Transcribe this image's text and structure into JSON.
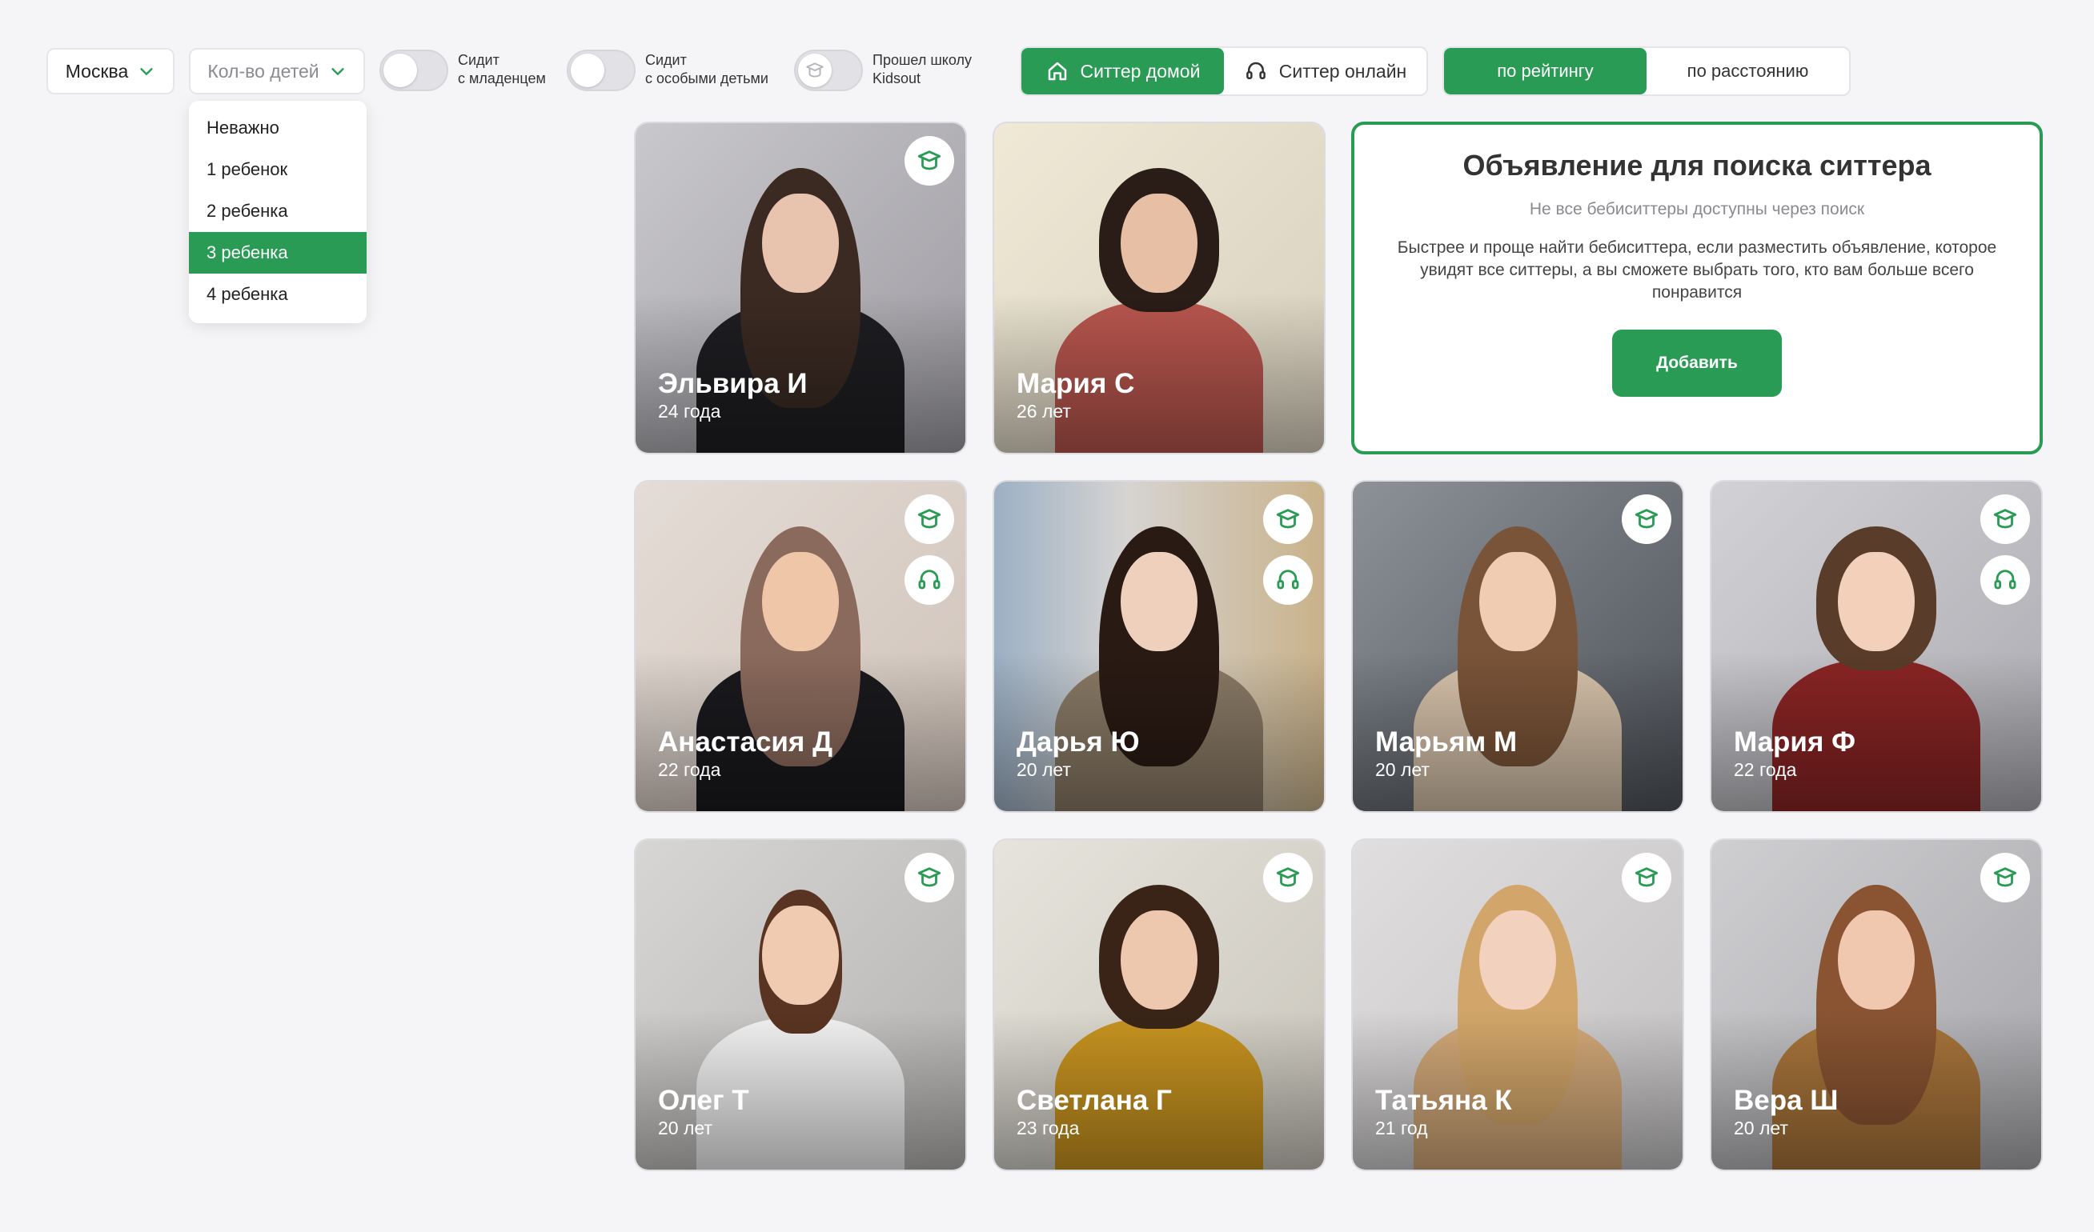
{
  "filters": {
    "city": "Москва",
    "kids_placeholder": "Кол-во детей",
    "toggle_baby_line1": "Сидит",
    "toggle_baby_line2": "с младенцем",
    "toggle_special_line1": "Сидит",
    "toggle_special_line2": "с особыми детьми",
    "toggle_school_line1": "Прошел школу",
    "toggle_school_line2": "Kidsout"
  },
  "mode": {
    "home": "Ситтер домой",
    "online": "Ситтер онлайн"
  },
  "sort": {
    "rating": "по рейтингу",
    "distance": "по расстоянию"
  },
  "dropdown": {
    "items": [
      "Неважно",
      "1 ребенок",
      "2 ребенка",
      "3 ребенка",
      "4 ребенка"
    ],
    "selected": "3 ребенка"
  },
  "ad": {
    "title": "Объявление для поиска ситтера",
    "subtitle": "Не все бебиситтеры доступны через поиск",
    "description": "Быстрее и проще найти бебиситтера, если разместить объявление, которое увидят все ситтеры, а вы сможете выбрать того, кто вам больше всего понравится",
    "button": "Добавить"
  },
  "colors": {
    "accent": "#2a9b55",
    "background": "#f5f5f7"
  },
  "sitters": [
    {
      "name": "Эльвира И",
      "age": "24 года",
      "badges": [
        "school-cap-icon"
      ]
    },
    {
      "name": "Мария С",
      "age": "26 лет",
      "badges": []
    },
    {
      "name": "Анастасия Д",
      "age": "22 года",
      "badges": [
        "school-cap-icon",
        "headset-icon"
      ]
    },
    {
      "name": "Дарья Ю",
      "age": "20 лет",
      "badges": [
        "school-cap-icon",
        "headset-icon"
      ]
    },
    {
      "name": "Марьям М",
      "age": "20 лет",
      "badges": [
        "school-cap-icon"
      ]
    },
    {
      "name": "Мария Ф",
      "age": "22 года",
      "badges": [
        "school-cap-icon",
        "headset-icon"
      ]
    },
    {
      "name": "Олег Т",
      "age": "20 лет",
      "badges": [
        "school-cap-icon"
      ]
    },
    {
      "name": "Светлана Г",
      "age": "23 года",
      "badges": [
        "school-cap-icon"
      ]
    },
    {
      "name": "Татьяна К",
      "age": "21 год",
      "badges": [
        "school-cap-icon"
      ]
    },
    {
      "name": "Вера Ш",
      "age": "20 лет",
      "badges": [
        "school-cap-icon"
      ]
    }
  ]
}
